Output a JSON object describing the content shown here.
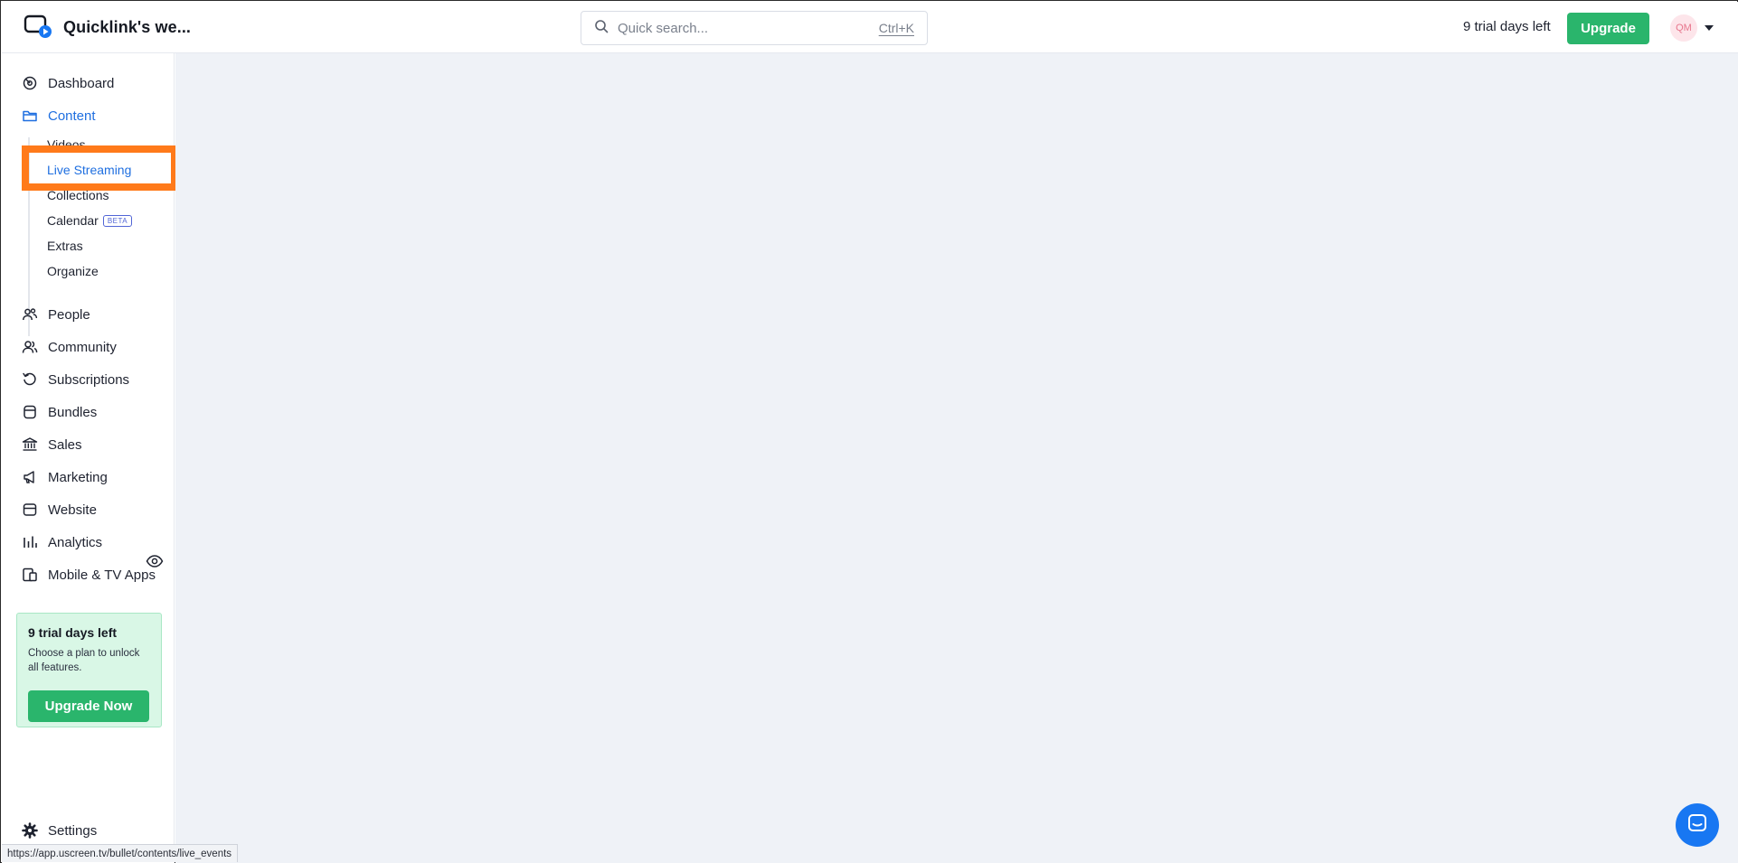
{
  "header": {
    "brand_name": "Quicklink's we...",
    "search_placeholder": "Quick search...",
    "search_shortcut": "Ctrl+K",
    "trial_text": "9 trial days left",
    "upgrade_label": "Upgrade",
    "avatar_initials": "QM"
  },
  "sidebar": {
    "items": [
      {
        "label": "Dashboard",
        "icon": "dashboard-icon"
      },
      {
        "label": "Content",
        "icon": "folder-icon"
      },
      {
        "label": "People",
        "icon": "people-icon"
      },
      {
        "label": "Community",
        "icon": "community-icon"
      },
      {
        "label": "Subscriptions",
        "icon": "subscriptions-icon"
      },
      {
        "label": "Bundles",
        "icon": "bundles-icon"
      },
      {
        "label": "Sales",
        "icon": "bank-icon"
      },
      {
        "label": "Marketing",
        "icon": "megaphone-icon"
      },
      {
        "label": "Website",
        "icon": "store-icon"
      },
      {
        "label": "Analytics",
        "icon": "bar-chart-icon"
      },
      {
        "label": "Mobile & TV Apps",
        "icon": "devices-icon"
      }
    ],
    "content_subitems": [
      {
        "label": "Videos"
      },
      {
        "label": "Live Streaming"
      },
      {
        "label": "Collections"
      },
      {
        "label": "Calendar",
        "badge": "BETA"
      },
      {
        "label": "Extras"
      },
      {
        "label": "Organize"
      }
    ],
    "trial_card": {
      "title": "9 trial days left",
      "text": "Choose a plan to unlock all features.",
      "button_label": "Upgrade Now"
    },
    "settings_label": "Settings"
  },
  "status_bar": {
    "url": "https://app.uscreen.tv/bullet/contents/live_events"
  },
  "colors": {
    "accent": "#1f6fe0",
    "green": "#2ab56c",
    "highlight": "#ff7a1a",
    "main_bg": "#eff2f7"
  }
}
